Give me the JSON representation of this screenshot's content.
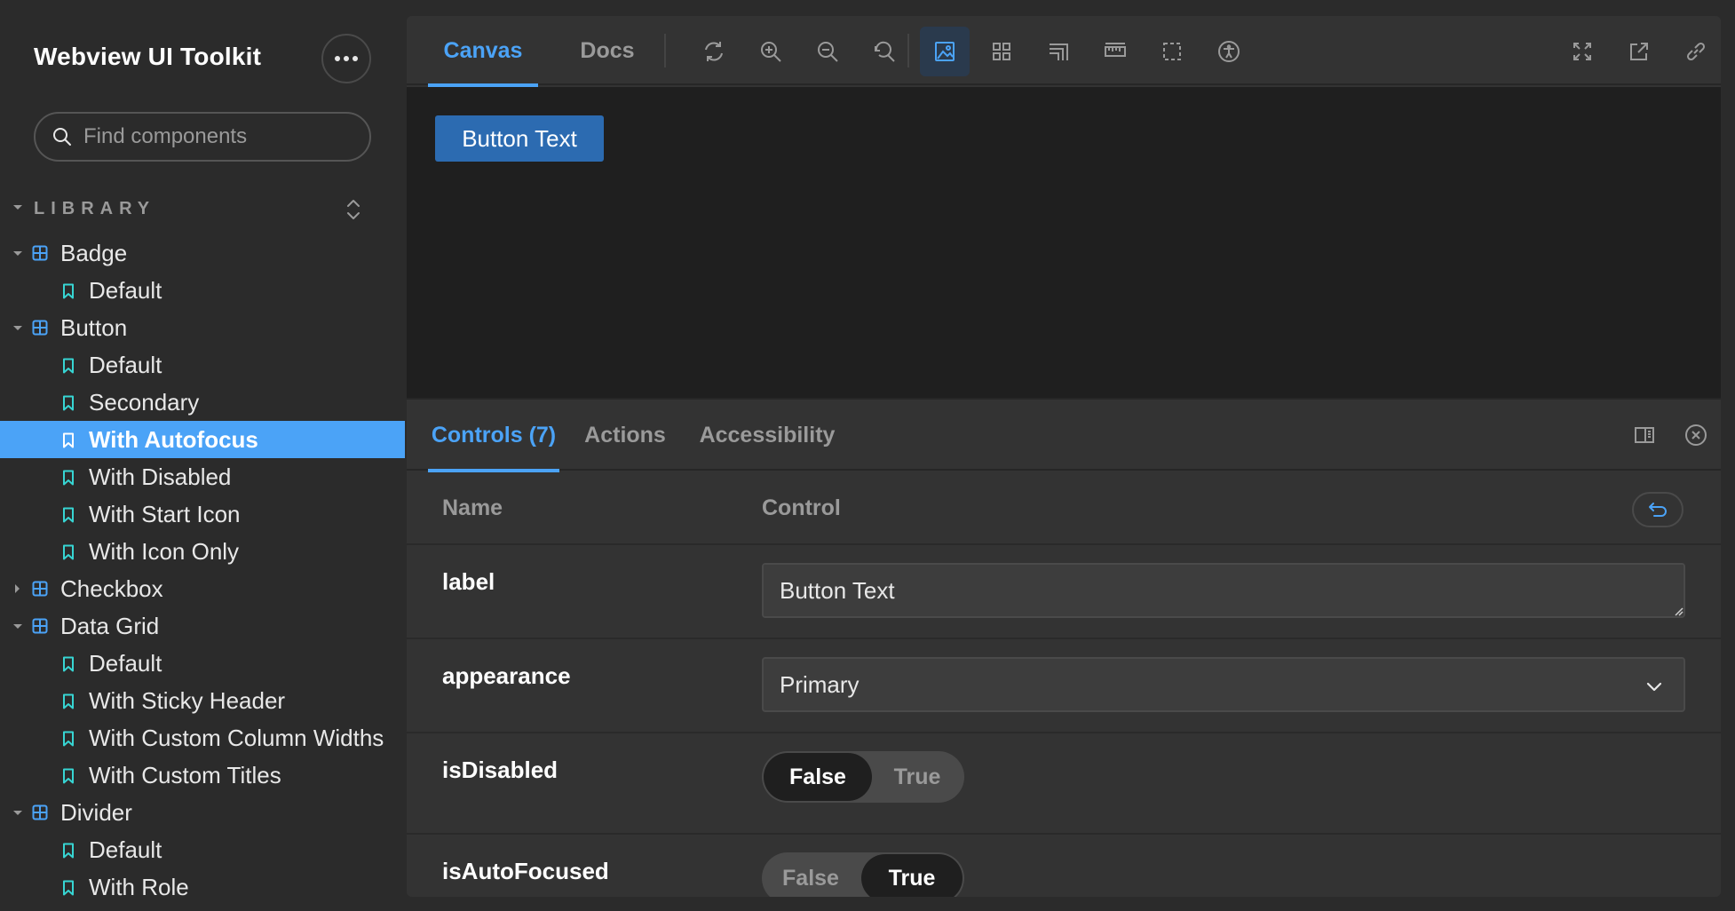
{
  "sidebar": {
    "brand": "Webview UI Toolkit",
    "search_placeholder": "Find components",
    "library_title": "LIBRARY",
    "items": [
      {
        "type": "component",
        "label": "Badge",
        "expanded": true
      },
      {
        "type": "story",
        "label": "Default"
      },
      {
        "type": "component",
        "label": "Button",
        "expanded": true
      },
      {
        "type": "story",
        "label": "Default"
      },
      {
        "type": "story",
        "label": "Secondary"
      },
      {
        "type": "story",
        "label": "With Autofocus",
        "selected": true
      },
      {
        "type": "story",
        "label": "With Disabled"
      },
      {
        "type": "story",
        "label": "With Start Icon"
      },
      {
        "type": "story",
        "label": "With Icon Only"
      },
      {
        "type": "component",
        "label": "Checkbox",
        "expanded": false
      },
      {
        "type": "component",
        "label": "Data Grid",
        "expanded": true
      },
      {
        "type": "story",
        "label": "Default"
      },
      {
        "type": "story",
        "label": "With Sticky Header"
      },
      {
        "type": "story",
        "label": "With Custom Column Widths"
      },
      {
        "type": "story",
        "label": "With Custom Titles"
      },
      {
        "type": "component",
        "label": "Divider",
        "expanded": true
      },
      {
        "type": "story",
        "label": "Default"
      },
      {
        "type": "story",
        "label": "With Role"
      }
    ]
  },
  "toolbar": {
    "tabs": [
      "Canvas",
      "Docs"
    ],
    "active_tab": "Canvas",
    "tools": [
      "refresh-icon",
      "zoom-in-icon",
      "zoom-out-icon",
      "zoom-reset-icon",
      "background-icon",
      "grid-icon",
      "viewport-icon",
      "measure-icon",
      "outline-icon",
      "accessibility-icon"
    ],
    "right_tools": [
      "fullscreen-icon",
      "open-new-tab-icon",
      "copy-link-icon"
    ]
  },
  "canvas": {
    "preview_button_label": "Button Text"
  },
  "addons": {
    "tabs": [
      "Controls (7)",
      "Actions",
      "Accessibility"
    ],
    "active_tab": "Controls (7)",
    "table": {
      "col_name": "Name",
      "col_control": "Control"
    },
    "controls": {
      "label": {
        "name": "label",
        "value": "Button Text"
      },
      "appearance": {
        "name": "appearance",
        "value": "Primary"
      },
      "isDisabled": {
        "name": "isDisabled",
        "false_label": "False",
        "true_label": "True",
        "selected": "False"
      },
      "isAutoFocused": {
        "name": "isAutoFocused",
        "false_label": "False",
        "true_label": "True",
        "selected": "True"
      }
    }
  },
  "colors": {
    "accent": "#4ba3f7",
    "preview_button": "#2c6bb1",
    "sidebar_bg": "#2b2b2b",
    "panel_bg": "#333333",
    "canvas_bg": "#1f1f1f"
  }
}
